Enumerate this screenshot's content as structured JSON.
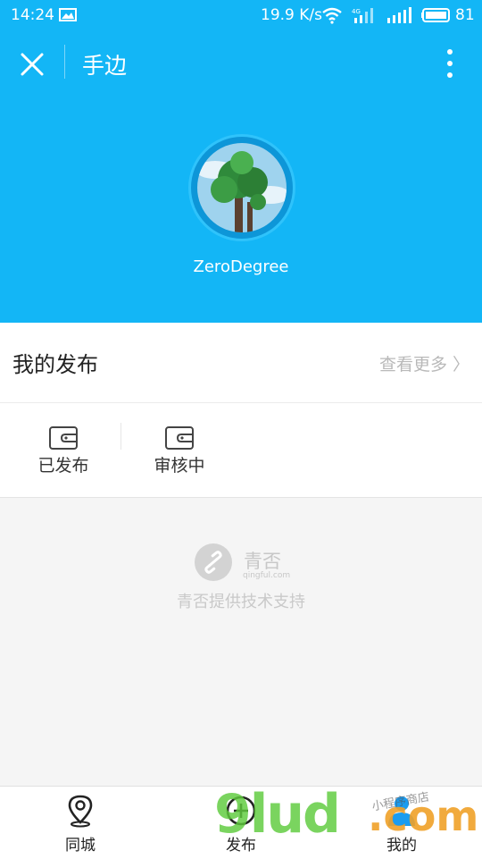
{
  "status_bar": {
    "time": "14:24",
    "net_speed": "19.9 K/s",
    "network_type": "4G",
    "battery": "81"
  },
  "header": {
    "title": "手边",
    "username": "ZeroDegree"
  },
  "my_posts": {
    "title": "我的发布",
    "see_more": "查看更多 〉"
  },
  "tabs": [
    {
      "label": "已发布",
      "icon": "wallet-icon"
    },
    {
      "label": "审核中",
      "icon": "wallet-icon"
    }
  ],
  "support": {
    "brand_name": "青否",
    "brand_domain": "qingful.com",
    "text": "青否提供技术支持"
  },
  "bottom_nav": [
    {
      "label": "同城",
      "icon": "location-pin-icon"
    },
    {
      "label": "发布",
      "icon": "plus-circle-icon"
    },
    {
      "label": "我的",
      "icon": "user-icon"
    }
  ],
  "watermark": {
    "letters": "9lud",
    "suffix": ".com",
    "handwriting": "小程序商店"
  },
  "colors": {
    "accent": "#13b6f6",
    "page_bg": "#f5f5f5"
  }
}
